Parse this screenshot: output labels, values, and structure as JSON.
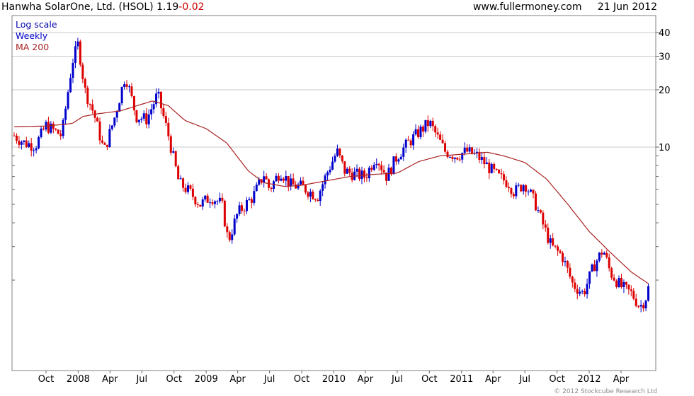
{
  "header": {
    "title": "Hanwha SolarOne, Ltd. (HSOL)",
    "last_price": "1.19",
    "change": "-0.02",
    "website": "www.fullermoney.com",
    "date": "21 Jun 2012"
  },
  "legend": {
    "scale": "Log scale",
    "interval": "Weekly",
    "ma_label": "MA 200"
  },
  "copyright": "© 2012 Stockcube Research Ltd",
  "colors": {
    "up": "#0000cc",
    "down": "#dd0000",
    "ma": "#aa2222",
    "grid": "#c8c8c8",
    "legend_scale": "#0000aa",
    "legend_interval": "#0000cc",
    "legend_ma": "#aa2222"
  },
  "chart_data": {
    "type": "candlestick",
    "scale": "log",
    "interval": "weekly",
    "y_ticks": [
      10,
      20,
      30,
      40
    ],
    "y_ticks_unlabeled": [
      2,
      3,
      4,
      5,
      6,
      7,
      8,
      9
    ],
    "x_tick_labels": [
      "Oct",
      "2008",
      "Apr",
      "Jul",
      "Oct",
      "2009",
      "Apr",
      "Jul",
      "Oct",
      "2010",
      "Apr",
      "Jul",
      "Oct",
      "2011",
      "Apr",
      "Jul",
      "Oct",
      "2012",
      "Apr"
    ],
    "x_tick_dates": [
      "2007-10-01",
      "2008-01-01",
      "2008-04-01",
      "2008-07-01",
      "2008-10-01",
      "2009-01-01",
      "2009-04-01",
      "2009-07-01",
      "2009-10-01",
      "2010-01-01",
      "2010-04-01",
      "2010-07-01",
      "2010-10-01",
      "2011-01-01",
      "2011-04-01",
      "2011-07-01",
      "2011-10-01",
      "2012-01-01",
      "2012-04-01"
    ],
    "x_range": [
      "2007-07-02",
      "2012-06-21"
    ],
    "price_path": [
      [
        "2007-07-02",
        11.5
      ],
      [
        "2007-08-01",
        10.5
      ],
      [
        "2007-09-01",
        10.2
      ],
      [
        "2007-10-01",
        13.0
      ],
      [
        "2007-11-15",
        11.5
      ],
      [
        "2007-12-15",
        28.0
      ],
      [
        "2008-01-01",
        35.0
      ],
      [
        "2008-01-20",
        20.0
      ],
      [
        "2008-02-15",
        15.0
      ],
      [
        "2008-03-15",
        9.5
      ],
      [
        "2008-04-15",
        14.5
      ],
      [
        "2008-05-15",
        24.0
      ],
      [
        "2008-06-15",
        14.5
      ],
      [
        "2008-07-15",
        14.0
      ],
      [
        "2008-08-15",
        19.0
      ],
      [
        "2008-09-15",
        11.5
      ],
      [
        "2008-10-15",
        6.5
      ],
      [
        "2008-11-15",
        5.8
      ],
      [
        "2008-12-15",
        5.0
      ],
      [
        "2009-01-15",
        5.5
      ],
      [
        "2009-02-15",
        5.0
      ],
      [
        "2009-03-05",
        3.2
      ],
      [
        "2009-04-01",
        4.5
      ],
      [
        "2009-05-15",
        5.5
      ],
      [
        "2009-06-15",
        7.2
      ],
      [
        "2009-07-01",
        6.0
      ],
      [
        "2009-08-01",
        7.5
      ],
      [
        "2009-09-01",
        6.3
      ],
      [
        "2009-10-01",
        6.2
      ],
      [
        "2009-11-15",
        5.5
      ],
      [
        "2009-12-15",
        7.5
      ],
      [
        "2010-01-10",
        9.5
      ],
      [
        "2010-02-01",
        7.5
      ],
      [
        "2010-03-01",
        7.2
      ],
      [
        "2010-04-01",
        7.0
      ],
      [
        "2010-05-01",
        9.0
      ],
      [
        "2010-06-01",
        7.0
      ],
      [
        "2010-07-01",
        9.0
      ],
      [
        "2010-08-01",
        10.5
      ],
      [
        "2010-09-01",
        12.0
      ],
      [
        "2010-10-01",
        13.5
      ],
      [
        "2010-11-15",
        9.5
      ],
      [
        "2010-12-15",
        9.0
      ],
      [
        "2011-01-15",
        9.5
      ],
      [
        "2011-02-15",
        9.0
      ],
      [
        "2011-03-15",
        8.0
      ],
      [
        "2011-04-15",
        7.0
      ],
      [
        "2011-05-15",
        6.5
      ],
      [
        "2011-06-01",
        5.8
      ],
      [
        "2011-07-01",
        6.5
      ],
      [
        "2011-08-01",
        5.0
      ],
      [
        "2011-08-20",
        4.0
      ],
      [
        "2011-09-15",
        3.0
      ],
      [
        "2011-10-15",
        2.7
      ],
      [
        "2011-11-15",
        1.9
      ],
      [
        "2011-12-15",
        1.7
      ],
      [
        "2012-01-15",
        2.4
      ],
      [
        "2012-02-10",
        2.9
      ],
      [
        "2012-03-01",
        2.2
      ],
      [
        "2012-04-01",
        1.85
      ],
      [
        "2012-05-01",
        1.7
      ],
      [
        "2012-05-25",
        1.45
      ],
      [
        "2012-06-10",
        1.6
      ],
      [
        "2012-06-21",
        1.9
      ]
    ],
    "ma200_path": [
      [
        "2007-07-02",
        12.8
      ],
      [
        "2007-10-01",
        12.9
      ],
      [
        "2007-12-15",
        13.3
      ],
      [
        "2008-01-15",
        14.5
      ],
      [
        "2008-03-01",
        15.0
      ],
      [
        "2008-05-01",
        15.5
      ],
      [
        "2008-08-01",
        17.5
      ],
      [
        "2008-09-15",
        16.5
      ],
      [
        "2008-11-01",
        13.8
      ],
      [
        "2009-01-01",
        12.5
      ],
      [
        "2009-03-01",
        10.5
      ],
      [
        "2009-05-01",
        7.5
      ],
      [
        "2009-06-15",
        6.5
      ],
      [
        "2009-08-15",
        6.2
      ],
      [
        "2009-10-01",
        6.3
      ],
      [
        "2009-12-01",
        6.6
      ],
      [
        "2010-02-15",
        7.0
      ],
      [
        "2010-05-01",
        7.2
      ],
      [
        "2010-07-01",
        7.3
      ],
      [
        "2010-09-01",
        8.4
      ],
      [
        "2010-11-01",
        9.0
      ],
      [
        "2011-01-15",
        9.2
      ],
      [
        "2011-03-15",
        9.4
      ],
      [
        "2011-05-01",
        9.0
      ],
      [
        "2011-07-01",
        8.3
      ],
      [
        "2011-09-01",
        6.8
      ],
      [
        "2011-11-01",
        5.0
      ],
      [
        "2012-01-01",
        3.6
      ],
      [
        "2012-03-01",
        2.8
      ],
      [
        "2012-05-01",
        2.2
      ],
      [
        "2012-06-21",
        1.9
      ]
    ]
  }
}
